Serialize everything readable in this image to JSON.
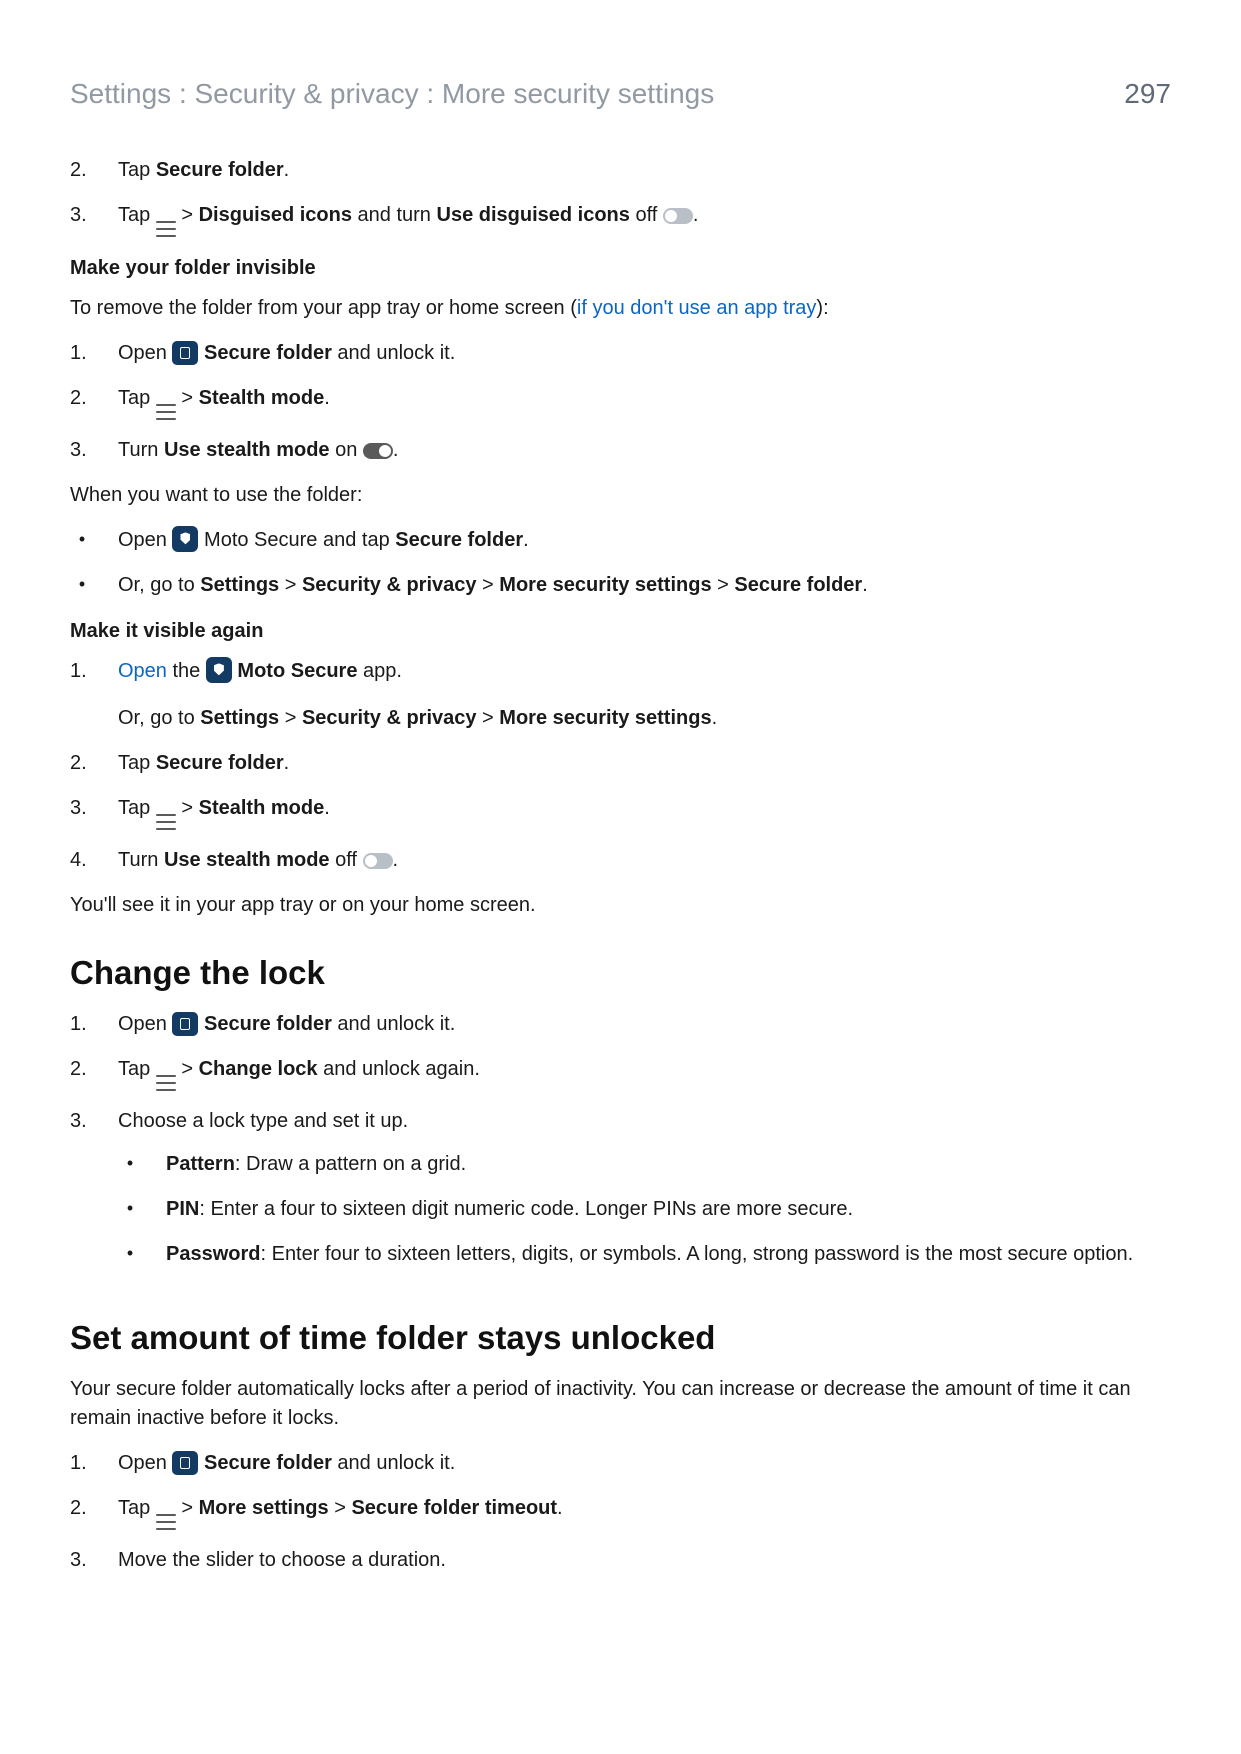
{
  "header": {
    "breadcrumb": "Settings : Security & privacy : More security settings",
    "page_number": "297"
  },
  "sec_a": {
    "step2_pre": "Tap ",
    "step2_bold": "Secure folder",
    "step2_post": ".",
    "step3_pre": "Tap ",
    "step3_mid1": " > ",
    "step3_bold1": "Disguised icons",
    "step3_mid2": " and turn ",
    "step3_bold2": "Use disguised icons",
    "step3_post": " off ",
    "step3_end": "."
  },
  "invisible": {
    "title": "Make your folder invisible",
    "intro_pre": "To remove the folder from your app tray or home screen (",
    "intro_link": "if you don't use an app tray",
    "intro_post": "):",
    "s1_pre": "Open ",
    "s1_bold": "Secure folder",
    "s1_post": " and unlock it.",
    "s2_pre": "Tap ",
    "s2_mid": " > ",
    "s2_bold": "Stealth mode",
    "s2_post": ".",
    "s3_pre": "Turn ",
    "s3_bold": "Use stealth mode",
    "s3_mid": " on ",
    "s3_post": ".",
    "when": "When you want to use the folder:",
    "b1_pre": "Open ",
    "b1_mid": " Moto Secure and tap ",
    "b1_bold": "Secure folder",
    "b1_post": ".",
    "b2_pre": "Or, go to ",
    "b2_b1": "Settings",
    "gt": " > ",
    "b2_b2": "Security & privacy",
    "b2_b3": "More security settings",
    "b2_b4": "Secure folder",
    "b2_post": "."
  },
  "visible": {
    "title": "Make it visible again",
    "s1_link": "Open",
    "s1_mid": " the ",
    "s1_bold": "Moto Secure",
    "s1_post": " app.",
    "s1b_pre": "Or, go to ",
    "s1b_b1": "Settings",
    "gt": " > ",
    "s1b_b2": "Security & privacy",
    "s1b_b3": "More security settings",
    "s1b_post": ".",
    "s2_pre": "Tap ",
    "s2_bold": "Secure folder",
    "s2_post": ".",
    "s3_pre": "Tap ",
    "s3_mid": " > ",
    "s3_bold": "Stealth mode",
    "s3_post": ".",
    "s4_pre": "Turn ",
    "s4_bold": "Use stealth mode",
    "s4_mid": " off ",
    "s4_post": ".",
    "outro": "You'll see it in your app tray or on your home screen."
  },
  "changelock": {
    "title": "Change the lock",
    "s1_pre": "Open ",
    "s1_bold": "Secure folder",
    "s1_post": " and unlock it.",
    "s2_pre": "Tap ",
    "s2_mid": " > ",
    "s2_bold": "Change lock",
    "s2_post": " and unlock again.",
    "s3": "Choose a lock type and set it up.",
    "b1_bold": "Pattern",
    "b1_post": ": Draw a pattern on a grid.",
    "b2_bold": "PIN",
    "b2_post": ": Enter a four to sixteen digit numeric code. Longer PINs are more secure.",
    "b3_bold": "Password",
    "b3_post": ": Enter four to sixteen letters, digits, or symbols. A long, strong password is the most secure option."
  },
  "timeout": {
    "title": "Set amount of time folder stays unlocked",
    "intro": "Your secure folder automatically locks after a period of inactivity. You can increase or decrease the amount of time it can remain inactive before it locks.",
    "s1_pre": "Open ",
    "s1_bold": "Secure folder",
    "s1_post": " and unlock it.",
    "s2_pre": "Tap ",
    "s2_mid": " > ",
    "s2_bold1": "More settings",
    "gt": " > ",
    "s2_bold2": "Secure folder timeout",
    "s2_post": ".",
    "s3": "Move the slider to choose a duration."
  },
  "nums": {
    "n1": "1.",
    "n2": "2.",
    "n3": "3.",
    "n4": "4."
  }
}
